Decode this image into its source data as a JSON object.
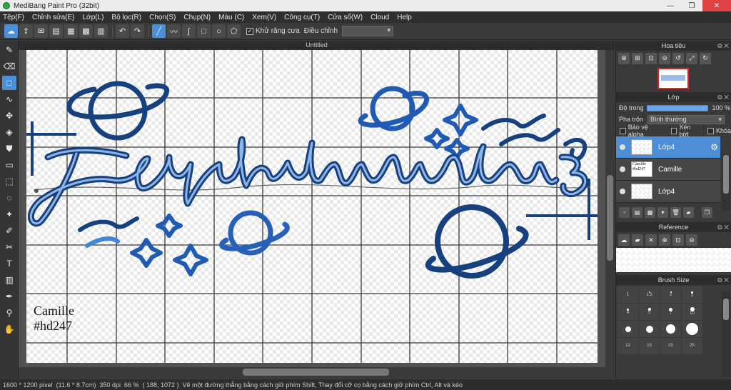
{
  "window": {
    "title": "MediBang Paint Pro (32bit)",
    "minimize_icon": "minimize-icon",
    "maximize_icon": "restore-icon",
    "close_icon": "close-icon"
  },
  "menu": [
    "Tệp(F)",
    "Chỉnh sửa(E)",
    "Lớp(L)",
    "Bộ lọc(R)",
    "Chọn(S)",
    "Chụp(N)",
    "Màu (C)",
    "Xem(V)",
    "Công cụ(T)",
    "Cửa sổ(W)",
    "Cloud",
    "Help"
  ],
  "toolbar": {
    "antialias_label": "Khử răng cưa",
    "antialias_checked": true,
    "adjust_label": "Điều chỉnh",
    "adjust_value": ""
  },
  "document": {
    "tab_title": "Untitled"
  },
  "canvas_text": {
    "line1": "Camille",
    "line2": "#hd247"
  },
  "status": {
    "size": "1600 * 1200 pixel",
    "physical": "(11.6 * 8.7cm)",
    "dpi": "350 dpi",
    "zoom": "66 %",
    "coords": "( 188, 1072 )",
    "hint": "Vẽ một đường thẳng bằng cách giữ phím Shift, Thay đổi cỡ cọ bằng cách giữ phím Ctrl, Alt và kéo"
  },
  "panels": {
    "navigator": {
      "title": "Hoa tiêu"
    },
    "layers": {
      "title": "Lớp",
      "opacity_label": "Độ trong",
      "opacity_value": "100 %",
      "opacity": 1.0,
      "blend_label": "Pha trộn",
      "blend_value": "Bình thường",
      "protect_alpha": "Bảo vệ alpha",
      "clipping": "Xén bớt",
      "lock": "Khóa",
      "items": [
        {
          "name": "Lớp4",
          "selected": true,
          "thumb_text": ""
        },
        {
          "name": "Camille",
          "selected": false,
          "thumb_text": "Camille #hd247"
        },
        {
          "name": "Lớp4",
          "selected": false,
          "thumb_text": ""
        }
      ]
    },
    "reference": {
      "title": "Reference"
    },
    "brush_size": {
      "title": "Brush Size",
      "labels": [
        "1",
        "1.5",
        "2",
        "3",
        "4",
        "5",
        "7",
        "10",
        "",
        "",
        "",
        "",
        "12",
        "15",
        "20",
        "25",
        "",
        "",
        "",
        ""
      ]
    }
  },
  "colors": {
    "accent": "#4d8fd6",
    "stroke_dark": "#16407e",
    "stroke_mid": "#1f5bb5",
    "stroke_light": "#3e86d6"
  }
}
